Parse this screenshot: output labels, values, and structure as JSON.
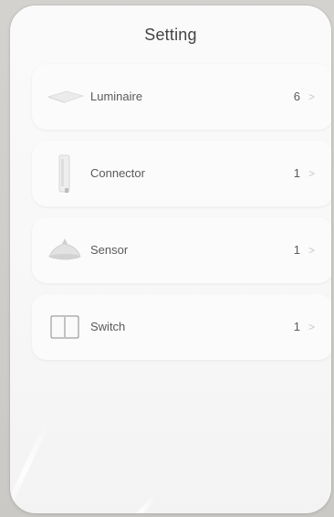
{
  "title": "Setting",
  "items": [
    {
      "label": "Luminaire",
      "count": "6",
      "icon": "luminaire-icon",
      "chevron": ">"
    },
    {
      "label": "Connector",
      "count": "1",
      "icon": "connector-icon",
      "chevron": ">"
    },
    {
      "label": "Sensor",
      "count": "1",
      "icon": "sensor-icon",
      "chevron": ">"
    },
    {
      "label": "Switch",
      "count": "1",
      "icon": "switch-icon",
      "chevron": ">"
    }
  ]
}
